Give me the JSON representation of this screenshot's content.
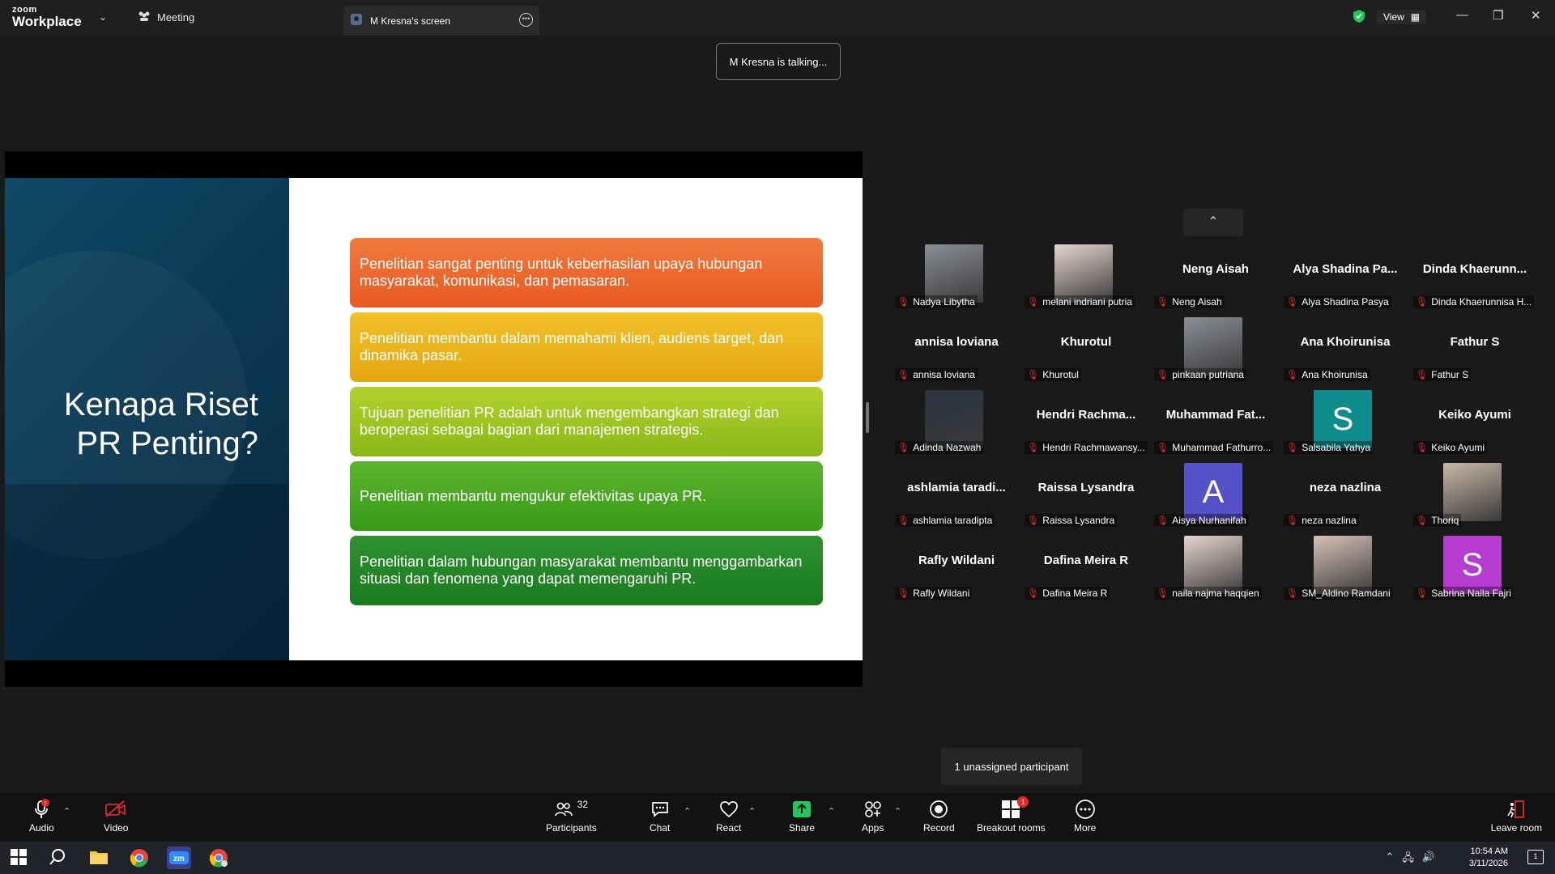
{
  "titlebar": {
    "logo_top": "zoom",
    "logo_bottom": "Workplace",
    "meeting_label": "Meeting",
    "tab_label": "M Kresna's screen",
    "view_label": "View",
    "colors": {
      "shield": "#22c55e"
    }
  },
  "talking_indicator": "M Kresna is talking...",
  "slide": {
    "title": "Kenapa Riset PR Penting?",
    "boxes": [
      "Penelitian sangat penting untuk keberhasilan upaya hubungan masyarakat, komunikasi, dan pemasaran.",
      "Penelitian membantu dalam memahami klien, audiens target, dan dinamika pasar.",
      "Tujuan penelitian PR adalah untuk mengembangkan strategi dan beroperasi sebagai bagian dari manajemen strategis.",
      "Penelitian membantu mengukur efektivitas upaya PR.",
      "Penelitian dalam hubungan masyarakat membantu menggambarkan situasi dan fenomena yang dapat memengaruhi PR."
    ]
  },
  "gallery": {
    "tiles": [
      {
        "label": "Nadya Libytha",
        "name": "",
        "avatar": "photo"
      },
      {
        "label": "melani indriani putria",
        "name": "",
        "avatar": "photo"
      },
      {
        "label": "Neng Aisah",
        "name": "Neng Aisah",
        "avatar": ""
      },
      {
        "label": "Alya Shadina Pasya",
        "name": "Alya Shadina Pa...",
        "avatar": ""
      },
      {
        "label": "Dinda Khaerunnisa H...",
        "name": "Dinda Khaerunn...",
        "avatar": ""
      },
      {
        "label": "annisa loviana",
        "name": "annisa loviana",
        "avatar": ""
      },
      {
        "label": "Khurotul",
        "name": "Khurotul",
        "avatar": ""
      },
      {
        "label": "pinkaan putriana",
        "name": "",
        "avatar": "photo"
      },
      {
        "label": "Ana Khoirunisa",
        "name": "Ana Khoirunisa",
        "avatar": ""
      },
      {
        "label": "Fathur S",
        "name": "Fathur S",
        "avatar": ""
      },
      {
        "label": "Adinda Nazwah",
        "name": "",
        "avatar": "photo"
      },
      {
        "label": "Hendri Rachmawansy...",
        "name": "Hendri Rachma...",
        "avatar": ""
      },
      {
        "label": "Muhammad Fathurro...",
        "name": "Muhammad Fat...",
        "avatar": ""
      },
      {
        "label": "Salsabila Yahya",
        "name": "",
        "avatar": "letter",
        "letter": "S",
        "color": "#0e8c8c"
      },
      {
        "label": "Keiko Ayumi",
        "name": "Keiko Ayumi",
        "avatar": ""
      },
      {
        "label": "ashlamia taradipta",
        "name": "ashlamia taradi...",
        "avatar": ""
      },
      {
        "label": "Raissa Lysandra",
        "name": "Raissa Lysandra",
        "avatar": ""
      },
      {
        "label": "Aisya Nurhanifah",
        "name": "",
        "avatar": "letter",
        "letter": "A",
        "color": "#5552c9"
      },
      {
        "label": "neza nazlina",
        "name": "neza nazlina",
        "avatar": ""
      },
      {
        "label": "Thoriq",
        "name": "",
        "avatar": "photo"
      },
      {
        "label": "Rafly Wildani",
        "name": "Rafly Wildani",
        "avatar": ""
      },
      {
        "label": "Dafina Meira R",
        "name": "Dafina Meira R",
        "avatar": ""
      },
      {
        "label": "naila najma haqqien",
        "name": "",
        "avatar": "photo"
      },
      {
        "label": "SM_Aldino Ramdani",
        "name": "",
        "avatar": "photo"
      },
      {
        "label": "Sabrina Naila Fajri",
        "name": "",
        "avatar": "letter",
        "letter": "S",
        "color": "#b63ccf"
      }
    ]
  },
  "unassigned_tooltip": "1 unassigned participant",
  "toolbar": {
    "audio": "Audio",
    "video": "Video",
    "participants": "Participants",
    "participants_count": "32",
    "chat": "Chat",
    "react": "React",
    "share": "Share",
    "apps": "Apps",
    "record": "Record",
    "breakout": "Breakout rooms",
    "breakout_badge": "1",
    "more": "More",
    "leave": "Leave room",
    "colors": {
      "share": "#22c55e",
      "badge": "#e02828"
    }
  },
  "taskbar": {
    "time": "10:54 AM",
    "date": "3/11/2026",
    "notification_count": "1"
  }
}
